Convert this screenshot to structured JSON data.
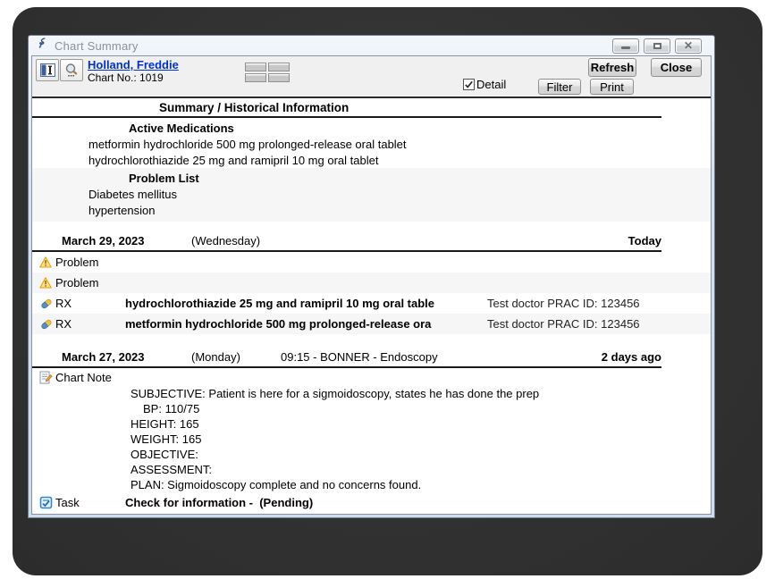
{
  "window": {
    "title": "Chart Summary"
  },
  "titlebar": {
    "buttons": {
      "minimize": "minimize",
      "maximize": "maximize",
      "close": "close"
    }
  },
  "toolbar": {
    "patient": {
      "name": "Holland, Freddie",
      "chart_no": "Chart No.: 1019"
    },
    "detail_label": "Detail",
    "buttons": {
      "refresh": "Refresh",
      "close": "Close",
      "filter": "Filter",
      "print": "Print"
    }
  },
  "icons": {
    "app": "chart-summary-logo-icon",
    "toolbar_left": [
      "panel-toggle-icon",
      "search-icon"
    ],
    "layout": "layout-grid-selector",
    "entry_types": {
      "problem": "warning-triangle-icon",
      "rx": "pill-icon",
      "chart_note": "note-pencil-icon",
      "task": "task-clipboard-icon"
    }
  },
  "colors": {
    "link": "#0033cc",
    "row_alt": "#f6f6f6",
    "warning_fill": "#ffe08a",
    "pill_blue": "#4e8fd0",
    "pill_yellow": "#f5c33b",
    "task_blue": "#2e86d0"
  },
  "summary": {
    "header": "Summary / Historical Information",
    "sections": [
      {
        "title": "Active Medications",
        "items": [
          "metformin hydrochloride 500 mg prolonged-release oral tablet",
          "hydrochlorothiazide 25 mg and ramipril 10 mg oral tablet"
        ]
      },
      {
        "title": "Problem List",
        "items": [
          "Diabetes mellitus",
          "hypertension"
        ]
      }
    ]
  },
  "timeline": [
    {
      "date": "March 29, 2023",
      "weekday": "(Wednesday)",
      "detail": "",
      "relative": "Today",
      "entries": [
        {
          "label": "Problem",
          "text": "",
          "right": ""
        },
        {
          "label": "Problem",
          "text": "",
          "right": ""
        },
        {
          "label": "RX",
          "text": "hydrochlorothiazide 25 mg and ramipril 10 mg oral table",
          "right": "Test doctor PRAC ID: 123456"
        },
        {
          "label": "RX",
          "text": "metformin hydrochloride 500 mg prolonged-release ora",
          "right": "Test doctor PRAC ID: 123456"
        }
      ]
    },
    {
      "date": "March 27, 2023",
      "weekday": "(Monday)",
      "detail": "09:15 - BONNER - Endoscopy",
      "relative": "2 days ago",
      "entries": [
        {
          "label": "Chart Note",
          "note_lines": [
            "SUBJECTIVE: Patient is here for a sigmoidoscopy, states he has done the prep",
            "BP: 110/75",
            "HEIGHT: 165",
            "WEIGHT: 165",
            "OBJECTIVE:",
            "ASSESSMENT:",
            "PLAN: Sigmoidoscopy complete and no concerns found."
          ]
        },
        {
          "label": "Task",
          "text": "Check for information -  (Pending)"
        }
      ]
    }
  ]
}
